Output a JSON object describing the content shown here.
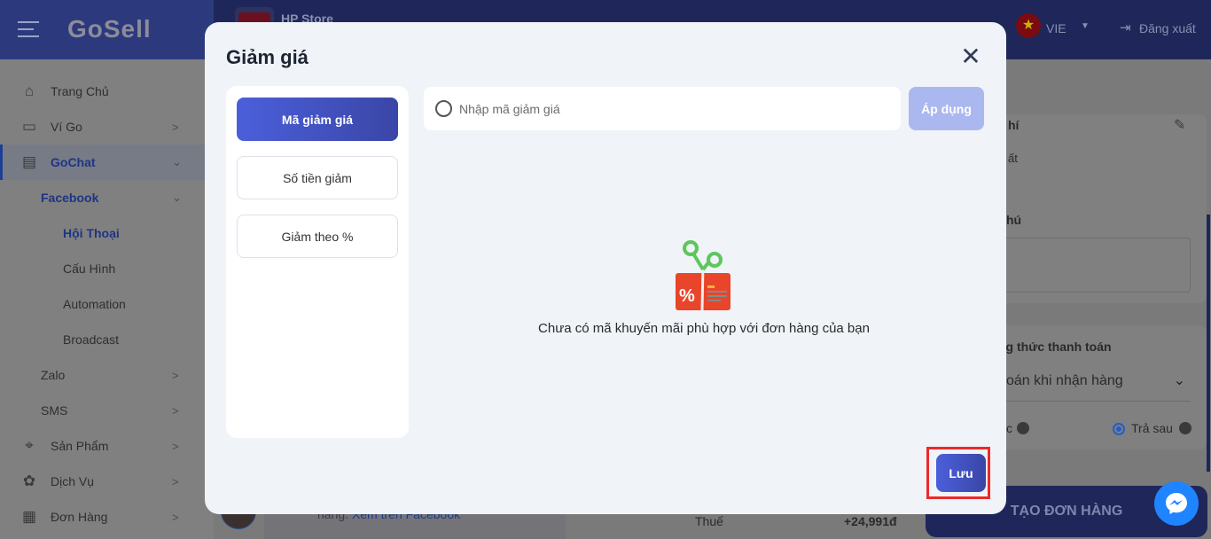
{
  "header": {
    "logo": "GoSell",
    "store_name": "HP Store",
    "language": "VIE",
    "logout": "Đăng xuất"
  },
  "sidebar": {
    "items": [
      {
        "label": "Trang Chủ",
        "icon": "home-icon"
      },
      {
        "label": "Ví Go",
        "icon": "wallet-icon"
      },
      {
        "label": "GoChat",
        "icon": "chat-icon"
      },
      {
        "label": "Facebook"
      },
      {
        "label": "Hội Thoại"
      },
      {
        "label": "Cấu Hình"
      },
      {
        "label": "Automation"
      },
      {
        "label": "Broadcast"
      },
      {
        "label": "Zalo"
      },
      {
        "label": "SMS"
      },
      {
        "label": "Sản Phẩm",
        "icon": "tag-icon"
      },
      {
        "label": "Dịch Vụ",
        "icon": "service-icon"
      },
      {
        "label": "Đơn Hàng",
        "icon": "order-icon"
      }
    ]
  },
  "background": {
    "fee_partial": "hí",
    "fee_sub_partial": "ất",
    "note_partial": "hú",
    "payment_title_partial": "ng thức thanh toán",
    "payment_method_partial": "oán khi nhận hàng",
    "prepay_partial": "c",
    "postpay": "Trả sau",
    "chat_link_prefix": "hàng.",
    "chat_link": "Xem trên Facebook",
    "tax_label": "Thuế",
    "tax_value": "+24,991đ",
    "create_order": "TẠO ĐƠN HÀNG"
  },
  "modal": {
    "title": "Giảm giá",
    "tabs": [
      {
        "label": "Mã giảm giá",
        "active": true
      },
      {
        "label": "Số tiền giảm"
      },
      {
        "label": "Giảm theo %"
      }
    ],
    "search_placeholder": "Nhập mã giảm giá",
    "search_value": "",
    "apply_label": "Áp dụng",
    "empty_message": "Chưa có mã khuyến mãi phù hợp với đơn hàng của bạn",
    "save_label": "Lưu"
  },
  "colors": {
    "accent": "#4b5fdb",
    "highlight_box": "#ec2a2a",
    "apply_disabled": "#abb8ef"
  }
}
